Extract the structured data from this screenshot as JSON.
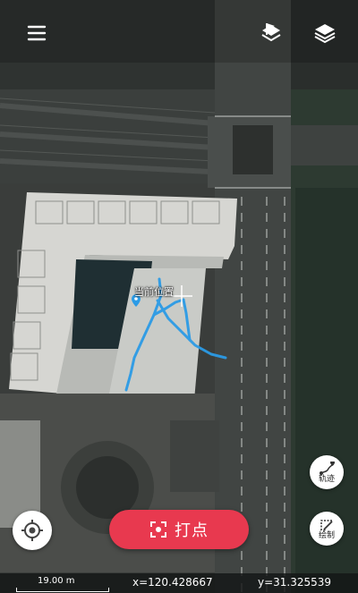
{
  "map": {
    "current_location_label": "当前位置"
  },
  "toolbar": {
    "menu_icon": "hamburger-menu-icon",
    "flag_icon": "map-flag-icon",
    "layers_icon": "layers-icon"
  },
  "tools": {
    "track_label": "轨迹",
    "draw_label": "绘制"
  },
  "actions": {
    "punch_label": "打点",
    "locate_icon": "locate-target-icon"
  },
  "status_bar": {
    "scale": "19.00 m",
    "x": "x=120.428667",
    "y": "y=31.325539"
  },
  "colors": {
    "accent": "#e8394f",
    "track": "#2b9be6",
    "marker": "#2b9be6"
  }
}
